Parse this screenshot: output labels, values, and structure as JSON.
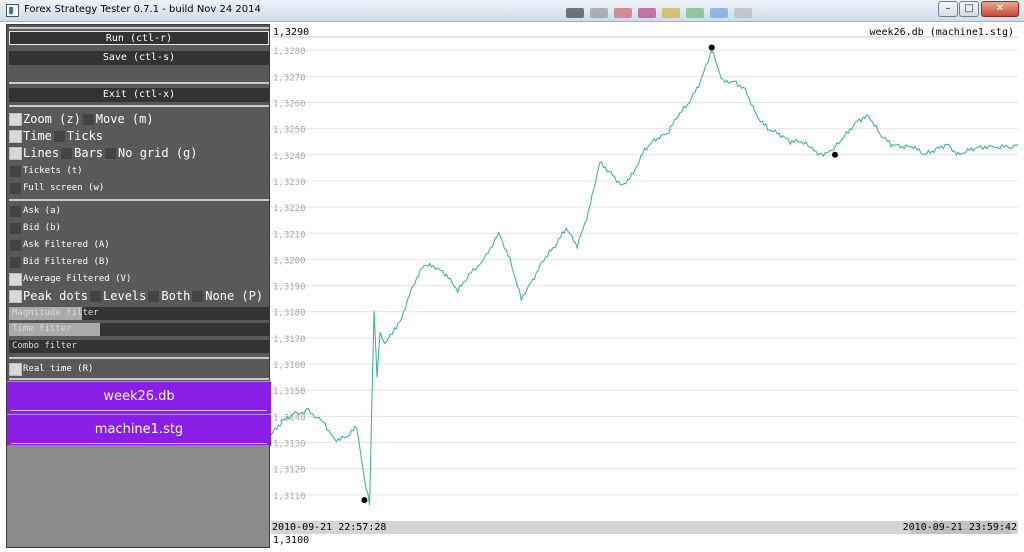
{
  "window": {
    "title": "Forex Strategy Tester 0.7.1 - build Nov 24 2014",
    "controls": {
      "minimize": "–",
      "maximize": "□",
      "close": "✕"
    }
  },
  "menu": {
    "run": "Run (ctl-r)",
    "save": "Save (ctl-s)",
    "exit": "Exit (ctl-x)"
  },
  "view_options": {
    "zoom": "Zoom (z)",
    "move": "Move (m)",
    "time": "Time",
    "ticks": "Ticks",
    "lines": "Lines",
    "bars": "Bars",
    "no_grid": "No grid (g)",
    "tickets": "Tickets (t)",
    "full_screen": "Full screen (w)"
  },
  "series_options": {
    "ask": "Ask (a)",
    "bid": "Bid (b)",
    "ask_filtered": "Ask Filtered (A)",
    "bid_filtered": "Bid Filtered (B)",
    "average_filtered": "Average Filtered (V)"
  },
  "peak_options": {
    "peak_dots": "Peak dots",
    "levels": "Levels",
    "both": "Both",
    "none": "None (P)"
  },
  "filters": {
    "magnitude": {
      "label": "Magnitude filter",
      "level": 0.28
    },
    "time": {
      "label": "Time filter",
      "level": 0.35
    },
    "combo": {
      "label": "Combo filter",
      "level": 0
    }
  },
  "real_time": "Real time (R)",
  "files": {
    "database": "week26.db",
    "strategy": "machine1.stg"
  },
  "chart": {
    "top_left": "1,3290",
    "top_right": "week26.db (machine1.stg)",
    "bottom_left_time": "2010-09-21 22:57:28",
    "bottom_right_time": "2010-09-21 23:59:42",
    "bottom_value": "1,3100",
    "line_color": "#3aa9a2"
  },
  "chart_data": {
    "type": "line",
    "ylim": [
      1.31,
      1.329
    ],
    "y_ticks": [
      "1,3280",
      "1,3270",
      "1,3260",
      "1,3250",
      "1,3240",
      "1,3230",
      "1,3220",
      "1,3210",
      "1,3200",
      "1,3190",
      "1,3180",
      "1,3170",
      "1,3160",
      "1,3150",
      "1,3140",
      "1,3130",
      "1,3120",
      "1,3110"
    ],
    "tick_values": [
      1.328,
      1.327,
      1.326,
      1.325,
      1.324,
      1.323,
      1.322,
      1.321,
      1.32,
      1.319,
      1.318,
      1.317,
      1.316,
      1.315,
      1.314,
      1.313,
      1.312,
      1.311
    ],
    "xlim": [
      0,
      100
    ],
    "series": [
      {
        "x": [
          0,
          1.5,
          3,
          5,
          7,
          8.5,
          10,
          11.5,
          12.5,
          13.2,
          13.8,
          14.2,
          14.6,
          15.2,
          15.7,
          16.5,
          17.5,
          19,
          20.5,
          22,
          23.5,
          25,
          26.5,
          28.5,
          30.5,
          32,
          33.5,
          35,
          36.5,
          38,
          39.5,
          41,
          42.5,
          44,
          45.5,
          47,
          48.5,
          50,
          51.5,
          53,
          54.5,
          56,
          57.5,
          59,
          60.5,
          62,
          63.5,
          65,
          66.5,
          68,
          69.5,
          71,
          72.2,
          73.2,
          74.2,
          75.5,
          77,
          78.5,
          80,
          81.5,
          83,
          84.5,
          86,
          87.5,
          89,
          90.5,
          92,
          93.5,
          95,
          97,
          99,
          100
        ],
        "y": [
          1.3133,
          1.3138,
          1.3141,
          1.3142,
          1.3138,
          1.3131,
          1.3132,
          1.3136,
          1.3116,
          1.3107,
          1.318,
          1.3155,
          1.3172,
          1.3167,
          1.317,
          1.3173,
          1.3178,
          1.319,
          1.3198,
          1.3197,
          1.3194,
          1.3188,
          1.3194,
          1.32,
          1.321,
          1.32,
          1.3185,
          1.3192,
          1.32,
          1.3205,
          1.3212,
          1.3205,
          1.3218,
          1.3237,
          1.3233,
          1.3228,
          1.3233,
          1.3242,
          1.3246,
          1.3248,
          1.3255,
          1.326,
          1.3268,
          1.328,
          1.3268,
          1.3268,
          1.3265,
          1.3255,
          1.325,
          1.3248,
          1.3245,
          1.3245,
          1.3243,
          1.324,
          1.324,
          1.3243,
          1.3248,
          1.3253,
          1.3255,
          1.3248,
          1.3244,
          1.3243,
          1.3243,
          1.324,
          1.3242,
          1.3244,
          1.324,
          1.3242,
          1.3243,
          1.3243,
          1.3243,
          1.3244
        ]
      }
    ],
    "peak_dots": [
      {
        "x": 12.5,
        "y": 1.3108
      },
      {
        "x": 59,
        "y": 1.3281
      },
      {
        "x": 75.5,
        "y": 1.324
      }
    ],
    "grid": true
  }
}
